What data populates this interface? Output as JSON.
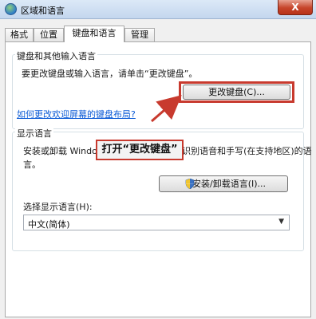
{
  "window": {
    "title": "区域和语言",
    "close_glyph": "X"
  },
  "tabs": [
    {
      "label": "格式",
      "active": false
    },
    {
      "label": "位置",
      "active": false
    },
    {
      "label": "键盘和语言",
      "active": true
    },
    {
      "label": "管理",
      "active": false
    }
  ],
  "keyboards_group": {
    "title": "键盘和其他输入语言",
    "description": "要更改键盘或输入语言，请单击“更改键盘”。",
    "change_keyboard_button": "更改键盘(C)...",
    "help_link": "如何更改欢迎屏幕的键盘布局?"
  },
  "display_language_group": {
    "title": "显示语言",
    "description_line1": "安装或卸载 Windows 可用于显示文本和识别语音和手写(在支持地区)的语",
    "description_line2": "言。",
    "install_button": "安装/卸载语言(I)...",
    "select_label": "选择显示语言(H):",
    "selected_language": "中文(简体)"
  },
  "annotation": {
    "callout_text": "打开“更改键盘”",
    "color": "#c83a2e"
  },
  "colors": {
    "highlight_border": "#c83a2e",
    "link": "#0a5ad6",
    "titlebar": "#c3d6ee"
  }
}
